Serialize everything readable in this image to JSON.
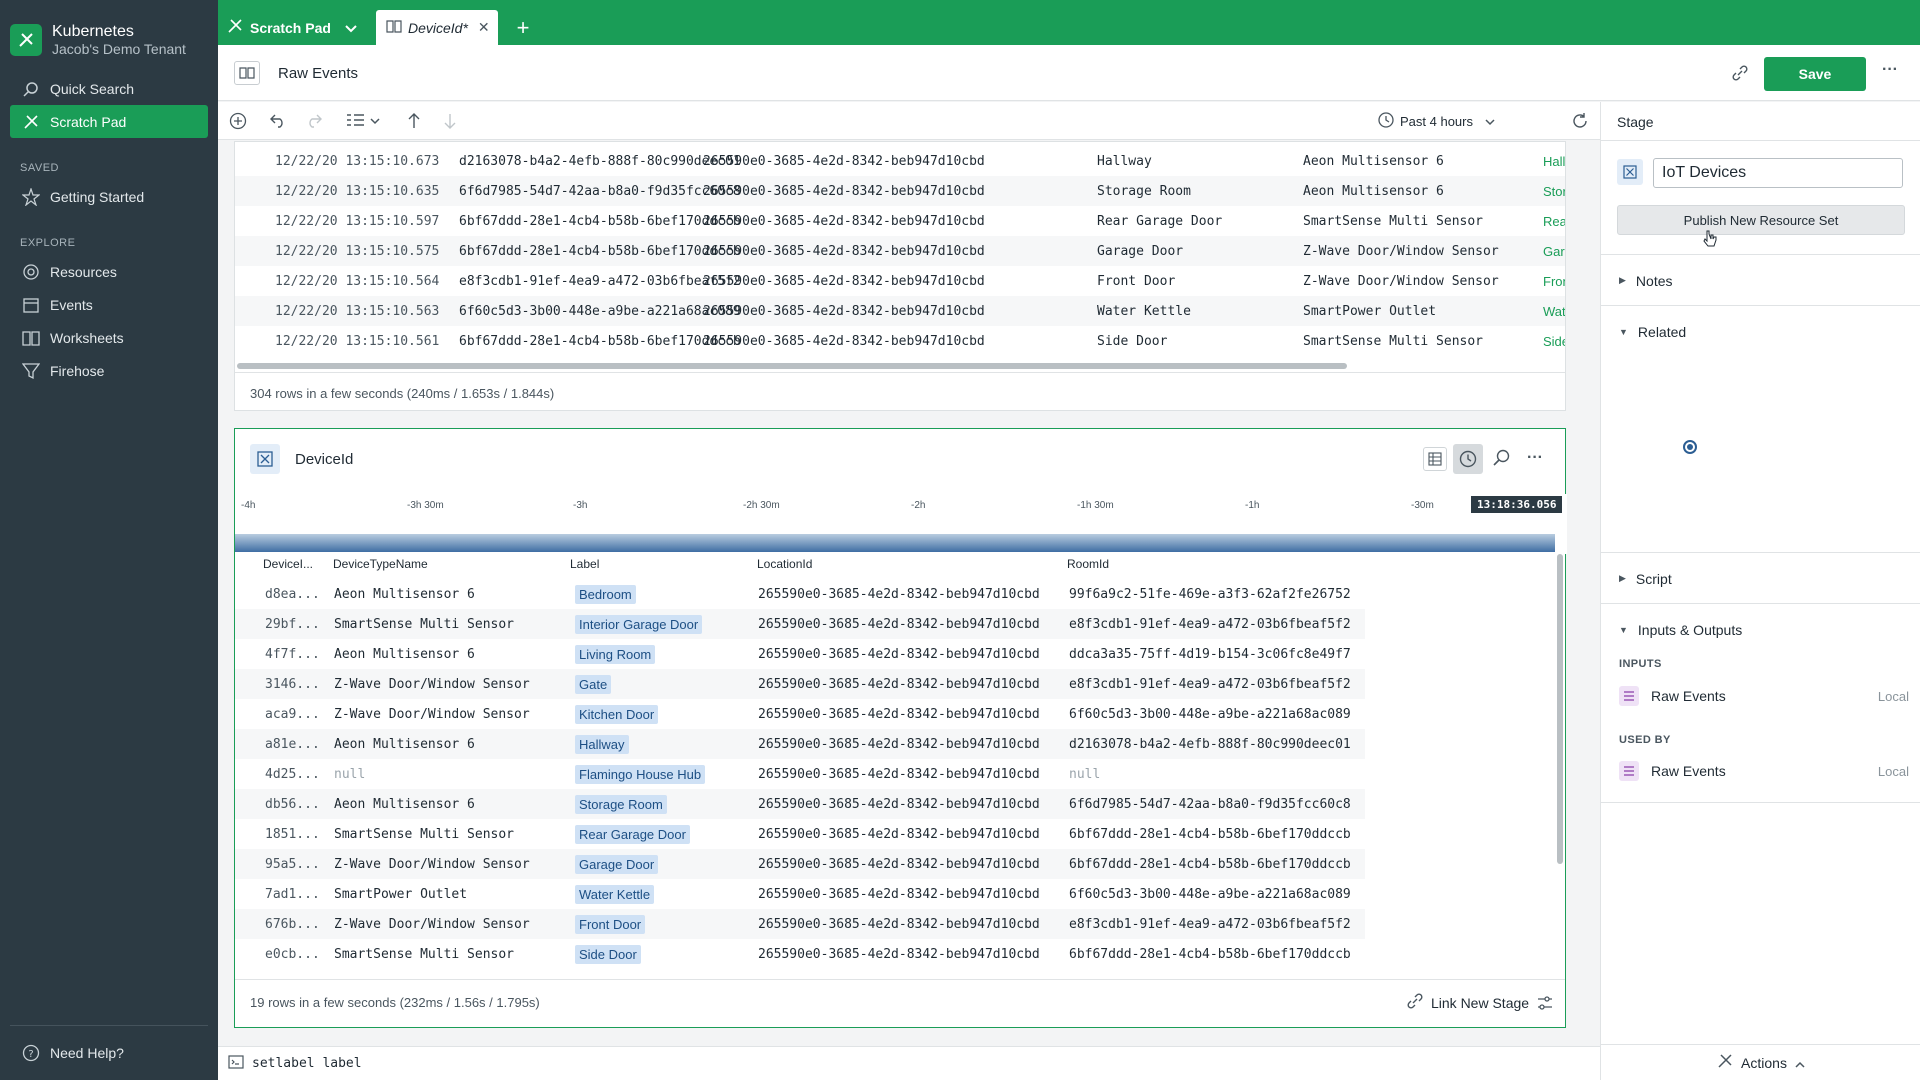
{
  "sidebar": {
    "brand_title": "Kubernetes",
    "brand_subtitle": "Jacob's Demo Tenant",
    "quick_search": "Quick Search",
    "scratch_pad": "Scratch Pad",
    "saved_label": "SAVED",
    "getting_started": "Getting Started",
    "explore_label": "EXPLORE",
    "explore_items": [
      "Resources",
      "Events",
      "Worksheets",
      "Firehose"
    ],
    "help": "Need Help?"
  },
  "tabs": {
    "tab1": "Scratch Pad",
    "tab2": "DeviceId*",
    "add": "+"
  },
  "header": {
    "title": "Raw Events",
    "save": "Save",
    "more": "···"
  },
  "toolbar": {
    "time_range": "Past 4 hours"
  },
  "raw_events": {
    "rows": [
      [
        "12/22/20 13:15:10.673",
        "d2163078-b4a2-4efb-888f-80c990deec01",
        "265590e0-3685-4e2d-8342-beb947d10cbd",
        "Hallway",
        "Aeon Multisensor 6",
        "Hallw"
      ],
      [
        "12/22/20 13:15:10.635",
        "6f6d7985-54d7-42aa-b8a0-f9d35fcc60c8",
        "265590e0-3685-4e2d-8342-beb947d10cbd",
        "Storage Room",
        "Aeon Multisensor 6",
        "Storag"
      ],
      [
        "12/22/20 13:15:10.597",
        "6bf67ddd-28e1-4cb4-b58b-6bef170ddccb",
        "265590e0-3685-4e2d-8342-beb947d10cbd",
        "Rear Garage Door",
        "SmartSense Multi Sensor",
        "Rear G"
      ],
      [
        "12/22/20 13:15:10.575",
        "6bf67ddd-28e1-4cb4-b58b-6bef170ddccb",
        "265590e0-3685-4e2d-8342-beb947d10cbd",
        "Garage Door",
        "Z-Wave Door/Window Sensor",
        "Garag"
      ],
      [
        "12/22/20 13:15:10.564",
        "e8f3cdb1-91ef-4ea9-a472-03b6fbeaf5f2",
        "265590e0-3685-4e2d-8342-beb947d10cbd",
        "Front Door",
        "Z-Wave Door/Window Sensor",
        "Front"
      ],
      [
        "12/22/20 13:15:10.563",
        "6f60c5d3-3b00-448e-a9be-a221a68ac089",
        "265590e0-3685-4e2d-8342-beb947d10cbd",
        "Water Kettle",
        "SmartPower Outlet",
        "Water"
      ],
      [
        "12/22/20 13:15:10.561",
        "6bf67ddd-28e1-4cb4-b58b-6bef170ddccb",
        "265590e0-3685-4e2d-8342-beb947d10cbd",
        "Side Door",
        "SmartSense Multi Sensor",
        "Side D"
      ]
    ],
    "status": "304 rows in a few seconds (240ms / 1.653s / 1.844s)"
  },
  "stage": {
    "title": "DeviceId",
    "ticks": [
      "-4h",
      "-3h 30m",
      "-3h",
      "-2h 30m",
      "-2h",
      "-1h 30m",
      "-1h",
      "-30m"
    ],
    "timestamp": "13:18:36.056",
    "columns": [
      "DeviceI...",
      "DeviceTypeName",
      "Label",
      "LocationId",
      "RoomId"
    ],
    "rows": [
      [
        "d8ea...",
        "Aeon Multisensor 6",
        "Bedroom",
        "265590e0-3685-4e2d-8342-beb947d10cbd",
        "99f6a9c2-51fe-469e-a3f3-62af2fe26752"
      ],
      [
        "29bf...",
        "SmartSense Multi Sensor",
        "Interior Garage Door",
        "265590e0-3685-4e2d-8342-beb947d10cbd",
        "e8f3cdb1-91ef-4ea9-a472-03b6fbeaf5f2"
      ],
      [
        "4f7f...",
        "Aeon Multisensor 6",
        "Living Room",
        "265590e0-3685-4e2d-8342-beb947d10cbd",
        "ddca3a35-75ff-4d19-b154-3c06fc8e49f7"
      ],
      [
        "3146...",
        "Z-Wave Door/Window Sensor",
        "Gate",
        "265590e0-3685-4e2d-8342-beb947d10cbd",
        "e8f3cdb1-91ef-4ea9-a472-03b6fbeaf5f2"
      ],
      [
        "aca9...",
        "Z-Wave Door/Window Sensor",
        "Kitchen Door",
        "265590e0-3685-4e2d-8342-beb947d10cbd",
        "6f60c5d3-3b00-448e-a9be-a221a68ac089"
      ],
      [
        "a81e...",
        "Aeon Multisensor 6",
        "Hallway",
        "265590e0-3685-4e2d-8342-beb947d10cbd",
        "d2163078-b4a2-4efb-888f-80c990deec01"
      ],
      [
        "4d25...",
        "null",
        "Flamingo House Hub",
        "265590e0-3685-4e2d-8342-beb947d10cbd",
        "null"
      ],
      [
        "db56...",
        "Aeon Multisensor 6",
        "Storage Room",
        "265590e0-3685-4e2d-8342-beb947d10cbd",
        "6f6d7985-54d7-42aa-b8a0-f9d35fcc60c8"
      ],
      [
        "1851...",
        "SmartSense Multi Sensor",
        "Rear Garage Door",
        "265590e0-3685-4e2d-8342-beb947d10cbd",
        "6bf67ddd-28e1-4cb4-b58b-6bef170ddccb"
      ],
      [
        "95a5...",
        "Z-Wave Door/Window Sensor",
        "Garage Door",
        "265590e0-3685-4e2d-8342-beb947d10cbd",
        "6bf67ddd-28e1-4cb4-b58b-6bef170ddccb"
      ],
      [
        "7ad1...",
        "SmartPower Outlet",
        "Water Kettle",
        "265590e0-3685-4e2d-8342-beb947d10cbd",
        "6f60c5d3-3b00-448e-a9be-a221a68ac089"
      ],
      [
        "676b...",
        "Z-Wave Door/Window Sensor",
        "Front Door",
        "265590e0-3685-4e2d-8342-beb947d10cbd",
        "e8f3cdb1-91ef-4ea9-a472-03b6fbeaf5f2"
      ],
      [
        "e0cb...",
        "SmartSense Multi Sensor",
        "Side Door",
        "265590e0-3685-4e2d-8342-beb947d10cbd",
        "6bf67ddd-28e1-4cb4-b58b-6bef170ddccb"
      ]
    ],
    "status": "19 rows in a few seconds (232ms / 1.56s / 1.795s)",
    "link_new_stage": "Link New Stage"
  },
  "right_panel": {
    "title": "Stage",
    "name_value": "IoT Devices",
    "publish": "Publish New Resource Set",
    "notes": "Notes",
    "related": "Related",
    "script": "Script",
    "io": "Inputs & Outputs",
    "inputs_label": "INPUTS",
    "input_name": "Raw Events",
    "input_loc": "Local",
    "used_by_label": "USED BY",
    "used_name": "Raw Events",
    "used_loc": "Local",
    "actions": "Actions"
  },
  "console": {
    "text": "setlabel label"
  },
  "colors": {
    "brand_green": "#1a9d57",
    "sidebar_bg": "#2c3a43",
    "label_bg": "#cfe1f5"
  }
}
